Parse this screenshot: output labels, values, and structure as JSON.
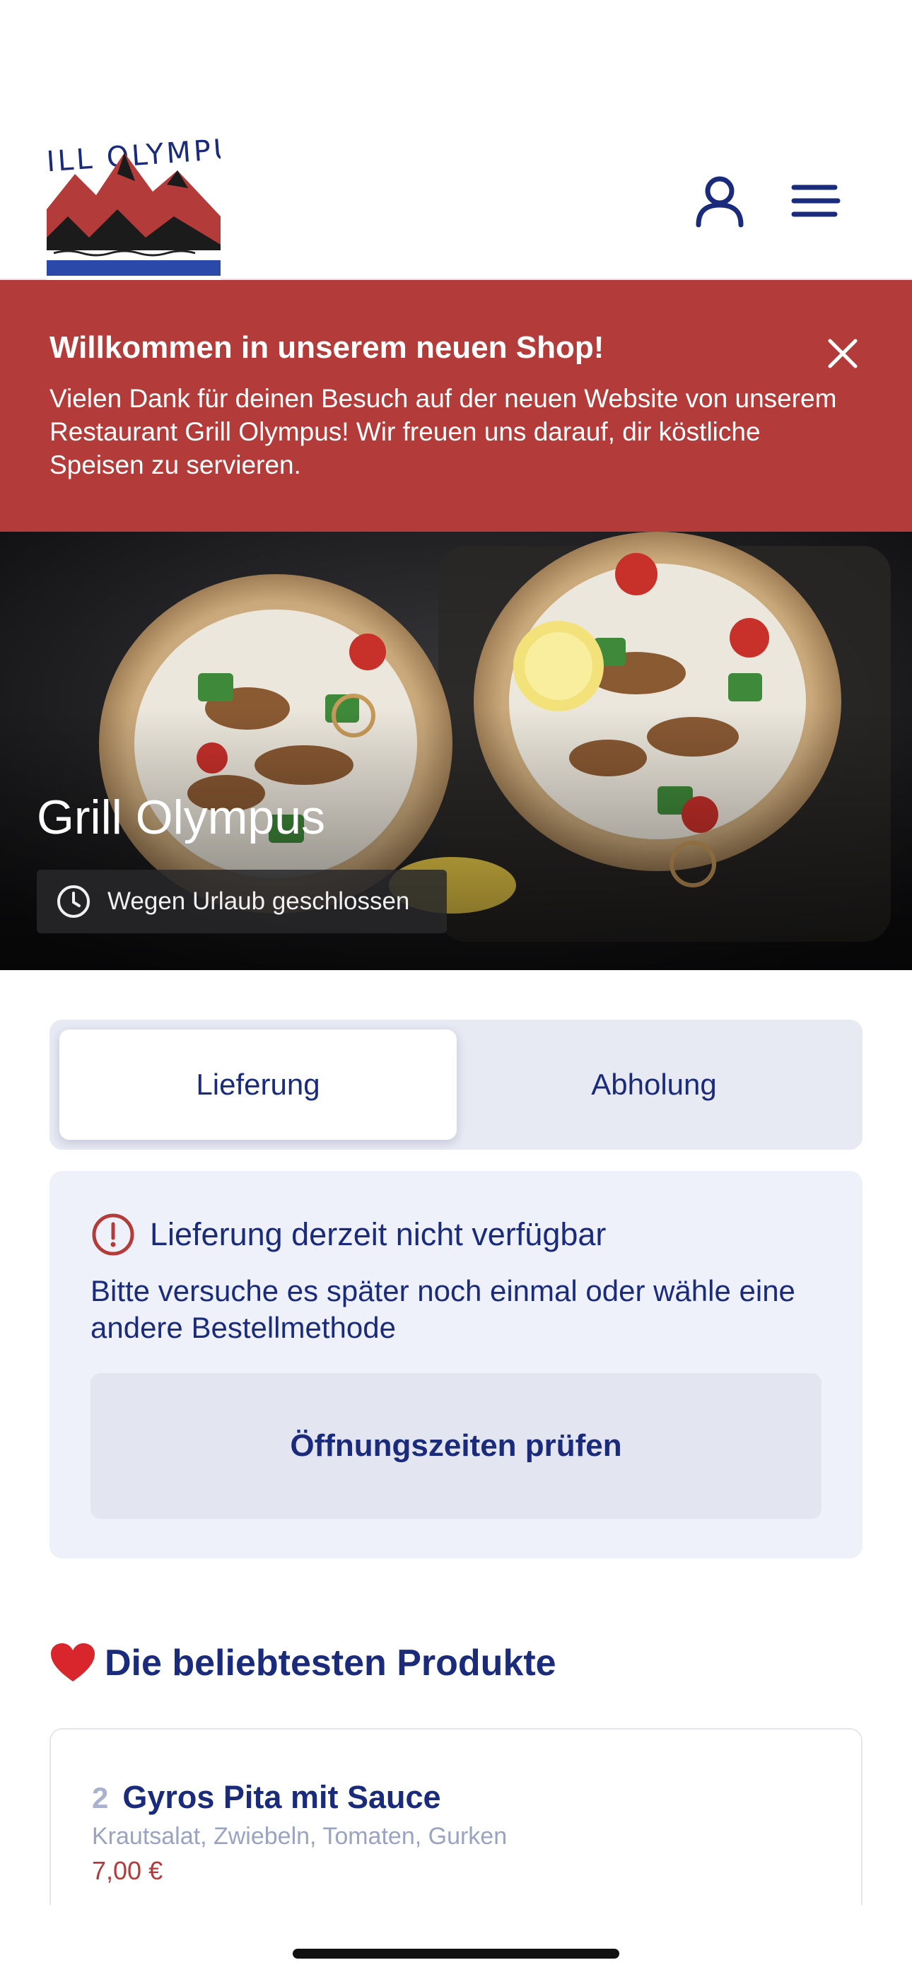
{
  "header": {
    "logo_text": "GRILL OLYMPUS",
    "icons": [
      "user-icon",
      "menu-icon"
    ]
  },
  "banner": {
    "title": "Willkommen in unserem neuen Shop!",
    "text": "Vielen Dank für deinen Besuch auf der neuen Website von unserem Restaurant Grill Olympus! Wir freuen uns darauf, dir köstliche Speisen zu servieren."
  },
  "hero": {
    "title": "Grill Olympus",
    "status": "Wegen Urlaub geschlossen"
  },
  "tabs": [
    {
      "label": "Lieferung",
      "active": true
    },
    {
      "label": "Abholung",
      "active": false
    }
  ],
  "notice": {
    "title": "Lieferung derzeit nicht verfügbar",
    "text": "Bitte versuche es später noch einmal oder wähle eine andere Bestellmethode",
    "button": "Öffnungszeiten prüfen"
  },
  "popular": {
    "title": "Die beliebtesten Produkte",
    "products": [
      {
        "qty": "2",
        "name": "Gyros Pita mit Sauce",
        "desc": "Krautsalat, Zwiebeln, Tomaten, Gurken",
        "price": "7,00 €"
      }
    ]
  },
  "colors": {
    "brand_blue": "#1a2b7c",
    "banner_red": "#b33b39",
    "tab_bg": "#e7e9f3",
    "notice_bg": "#eef1f9"
  }
}
